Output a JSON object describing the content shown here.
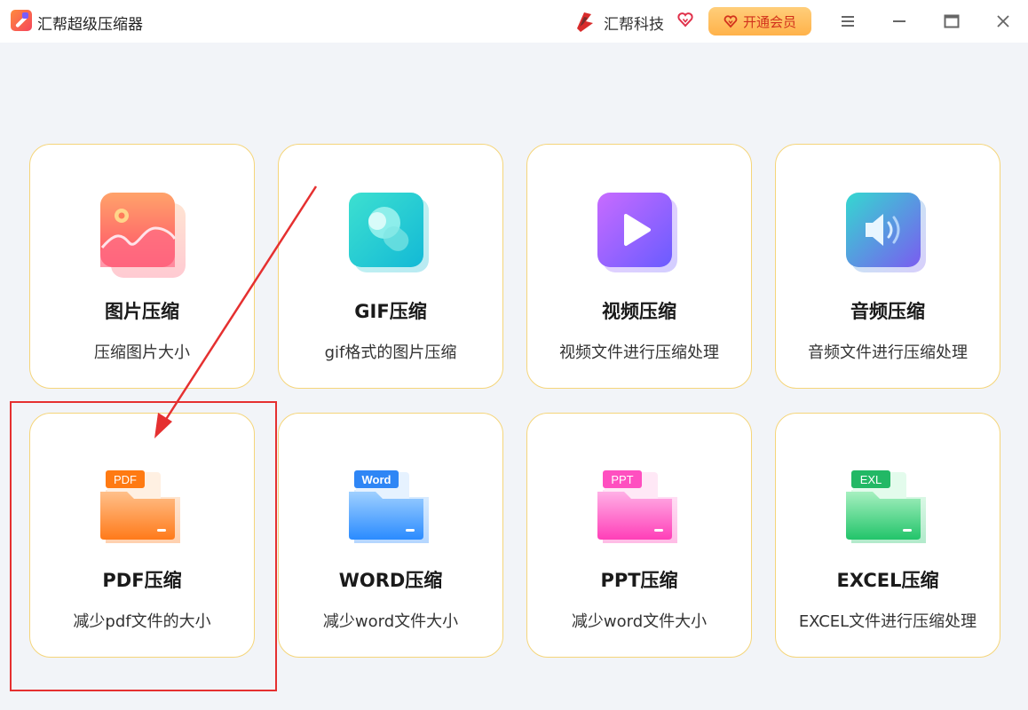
{
  "titlebar": {
    "app_title": "汇帮超级压缩器",
    "brand_name": "汇帮科技",
    "vip_button_label": "开通会员",
    "accent_color": "#ffb24a"
  },
  "cards": [
    {
      "title": "图片压缩",
      "desc": "压缩图片大小",
      "icon": "image-icon"
    },
    {
      "title": "GIF压缩",
      "desc": "gif格式的图片压缩",
      "icon": "gif-icon"
    },
    {
      "title": "视频压缩",
      "desc": "视频文件进行压缩处理",
      "icon": "video-play-icon"
    },
    {
      "title": "音频压缩",
      "desc": "音频文件进行压缩处理",
      "icon": "speaker-icon"
    },
    {
      "title": "PDF压缩",
      "desc": "减少pdf文件的大小",
      "icon": "pdf-folder-icon",
      "badge": "PDF"
    },
    {
      "title": "WORD压缩",
      "desc": "减少word文件大小",
      "icon": "word-folder-icon",
      "badge": "Word"
    },
    {
      "title": "PPT压缩",
      "desc": "减少word文件大小",
      "icon": "ppt-folder-icon",
      "badge": "PPT"
    },
    {
      "title": "EXCEL压缩",
      "desc": "EXCEL文件进行压缩处理",
      "icon": "excel-folder-icon",
      "badge": "EXL"
    }
  ],
  "annotation": {
    "color": "#e53030",
    "highlighted_card": "PDF压缩"
  }
}
